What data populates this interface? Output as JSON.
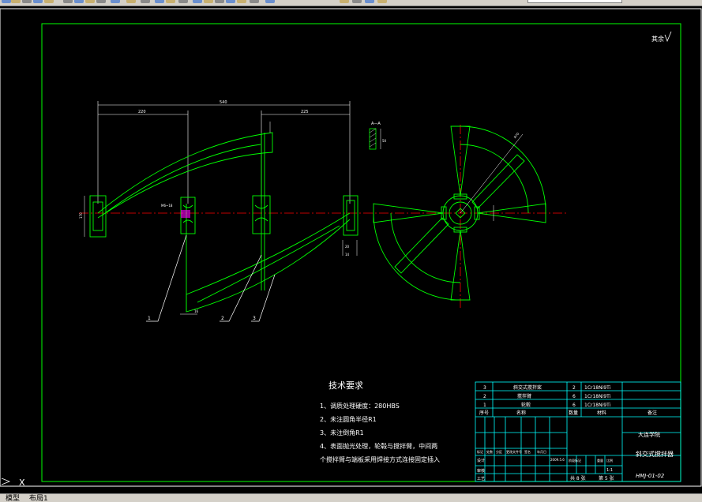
{
  "app": {
    "tabs": [
      "模型",
      "布局1"
    ]
  },
  "toolbar": {
    "icons": [
      "new-icon",
      "open-icon",
      "save-icon",
      "print-icon",
      "preview-icon",
      "cut-icon",
      "copy-icon",
      "paste-icon",
      "match-icon",
      "undo-icon",
      "redo-icon",
      "pan-icon",
      "zoom-realtime-icon",
      "zoom-window-icon",
      "zoom-previous-icon",
      "properties-icon",
      "designcenter-icon",
      "toolpalette-icon",
      "sheetset-icon",
      "markup-icon",
      "calculator-icon",
      "help-icon",
      "layer-icon",
      "layer-state-icon",
      "layer-previous-icon",
      "layer-color-icon"
    ],
    "layer_value": ""
  },
  "drawing": {
    "roughness_mark": "其余",
    "section_label": "A—A",
    "leaders": [
      "1",
      "2",
      "3"
    ],
    "dims": {
      "overall": "540",
      "left_span": "220",
      "right_span": "225",
      "radius": "R70",
      "left_height": "170",
      "bore_note": "M6~18",
      "right_hub": "20",
      "base_w": "14",
      "bottom_a": "16",
      "section_h": "50"
    },
    "tech_requirements": {
      "title": "技术要求",
      "items": [
        "1、调质处理硬度：280HBS",
        "2、未注圆角半径R1",
        "3、未注倒角R1",
        "4、表面抛光处理，轮毂与搅拌臂，中间两",
        "个搅拌臂与端板采用焊接方式连接固定插入"
      ]
    },
    "title_block": {
      "parts": [
        {
          "no": "3",
          "name": "斜交式搅拌桨",
          "qty": "2",
          "material": "1Cr18Ni9Ti"
        },
        {
          "no": "2",
          "name": "搅拌臂",
          "qty": "6",
          "material": "1Cr18Ni9Ti"
        },
        {
          "no": "1",
          "name": "轮毂",
          "qty": "6",
          "material": "1Cr18Ni9Ti"
        }
      ],
      "header": {
        "no": "序号",
        "name": "名称",
        "qty": "数量",
        "material": "材料",
        "remark": "备注"
      },
      "company": "大连学院",
      "title": "斜交式搅拌器",
      "drawing_no": "HMJ-01-02",
      "sign_labels": [
        "设计",
        "审核",
        "工艺"
      ],
      "sign_cols": [
        "标记",
        "处数",
        "分区",
        "更改文件号",
        "签名",
        "年月日"
      ],
      "date": "2009.5.6",
      "stage_labels": [
        "阶段标记",
        "重量",
        "比例"
      ],
      "scale": "1:1",
      "sheet_total": "共 8 张",
      "sheet_no": "第 5 张"
    }
  },
  "command": {
    "prompt_symbol": "X"
  },
  "colors": {
    "background": "#000000",
    "frame": "#00ff00",
    "outline": "#00ff00",
    "dimension": "#ffffff",
    "centerline": "#ff0000",
    "title_block": "#00ffff",
    "text": "#ffffff",
    "highlight": "#ff00ff",
    "leader": "#ffffff"
  }
}
